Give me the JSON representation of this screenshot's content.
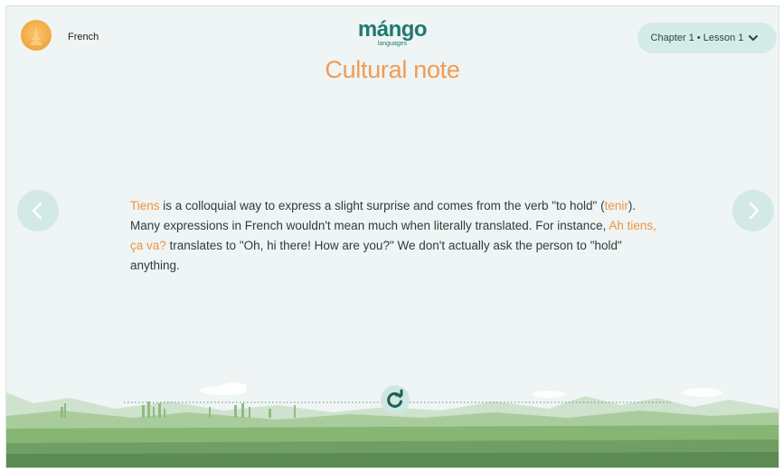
{
  "header": {
    "language_label": "French",
    "logo_text": "mángo",
    "logo_subtext": "languages",
    "title": "Cultural note",
    "chapter_selector": "Chapter 1 • Lesson 1"
  },
  "note": {
    "segments": [
      {
        "text": "Tiens",
        "highlight": true
      },
      {
        "text": " is a colloquial way to express a slight surprise and comes from the verb \"to hold\" (",
        "highlight": false
      },
      {
        "text": "tenir",
        "highlight": true
      },
      {
        "text": ").  Many expressions in French wouldn't mean much when literally translated.  For instance, ",
        "highlight": false
      },
      {
        "text": "Ah tiens, ça va?",
        "highlight": true
      },
      {
        "text": " translates to \"Oh, hi there! How are you?\"  We don't actually ask the person to \"hold\" anything.",
        "highlight": false
      }
    ]
  },
  "icons": {
    "flag": "french-flag-icon",
    "prev": "chevron-left-icon",
    "next": "chevron-right-icon",
    "chapter": "chevron-down-icon",
    "replay": "replay-icon"
  },
  "colors": {
    "accent": "#f39a53",
    "brand": "#1f7a6e",
    "background": "#eef5f4",
    "button": "#d5ebe8"
  }
}
